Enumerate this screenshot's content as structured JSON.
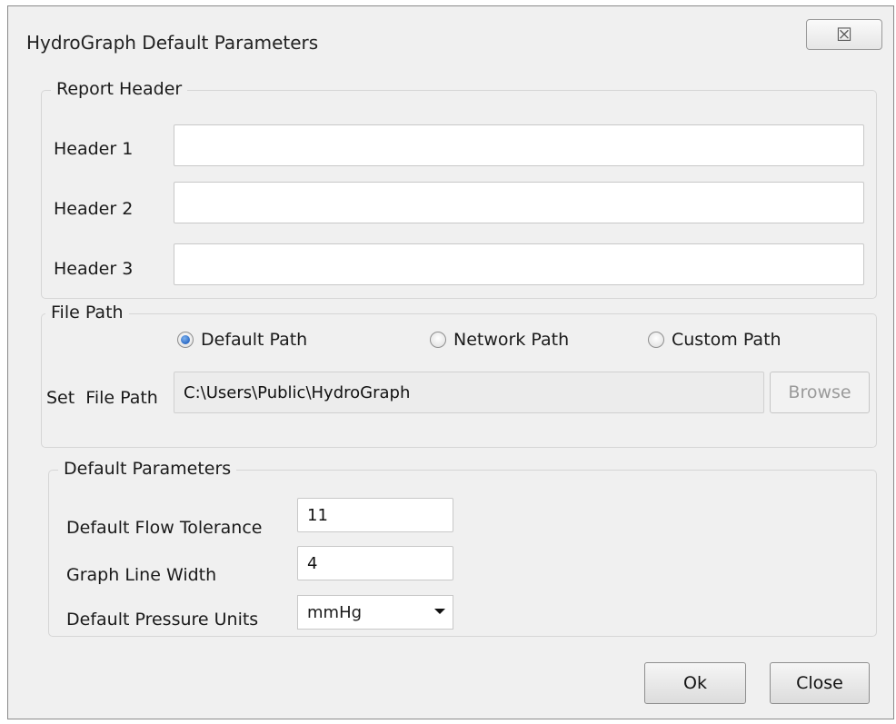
{
  "window": {
    "title": "HydroGraph Default Parameters",
    "close_glyph": "☒"
  },
  "report_header": {
    "legend": "Report Header",
    "rows": [
      {
        "label": "Header 1",
        "value": ""
      },
      {
        "label": "Header 2",
        "value": ""
      },
      {
        "label": "Header 3",
        "value": ""
      }
    ]
  },
  "file_path": {
    "legend": "File Path",
    "options": [
      {
        "label": "Default Path",
        "checked": true
      },
      {
        "label": "Network Path",
        "checked": false
      },
      {
        "label": "Custom Path",
        "checked": false
      }
    ],
    "set_label": "Set  File Path",
    "path_value": "C:\\Users\\Public\\HydroGraph",
    "browse_label": "Browse"
  },
  "default_parameters": {
    "legend": "Default Parameters",
    "flow_tolerance_label": "Default Flow Tolerance",
    "flow_tolerance_value": "11",
    "line_width_label": "Graph Line Width",
    "line_width_value": "4",
    "pressure_units_label": "Default Pressure Units",
    "pressure_units_value": "mmHg"
  },
  "footer": {
    "ok_label": "Ok",
    "close_label": "Close"
  }
}
